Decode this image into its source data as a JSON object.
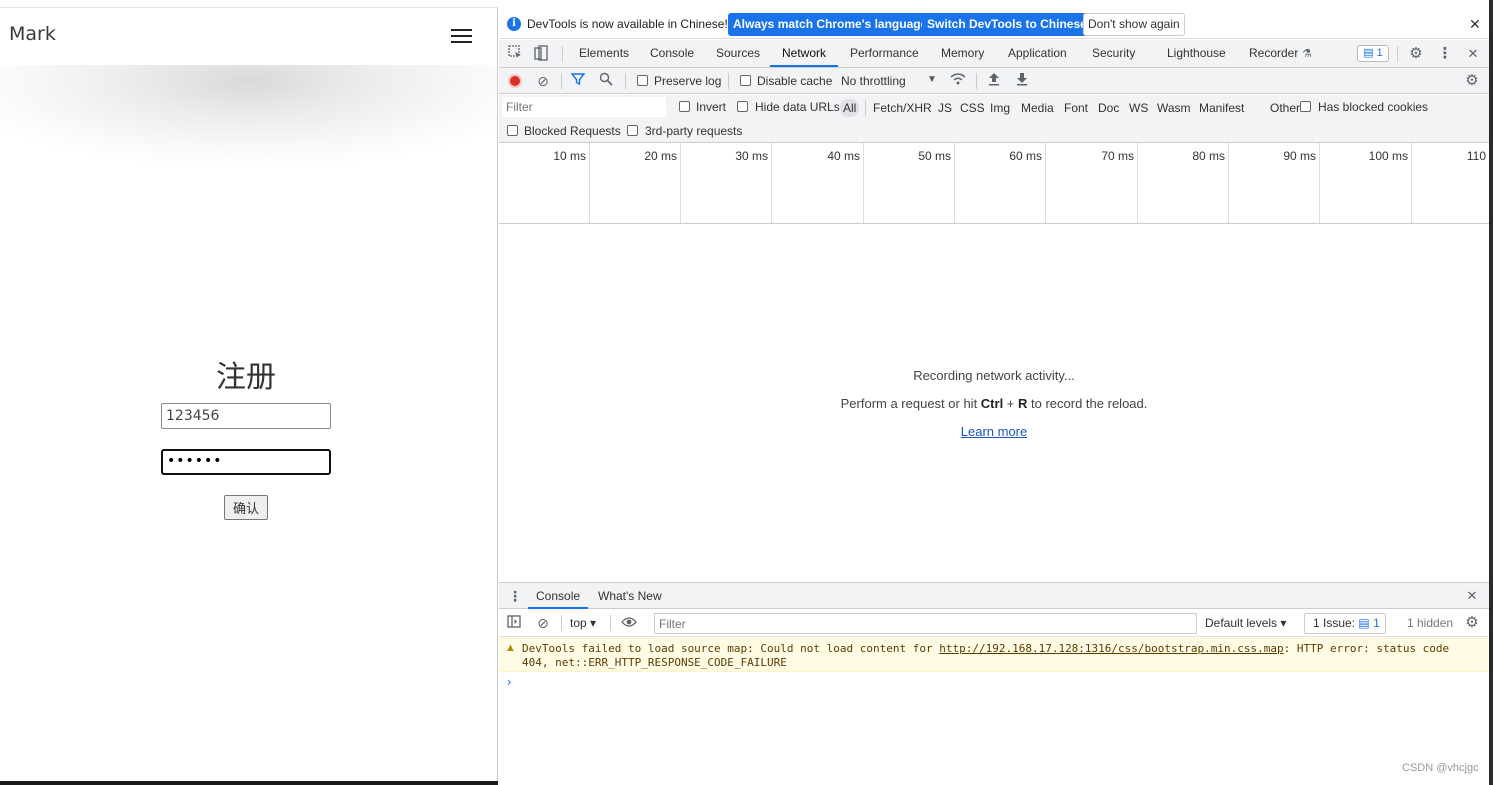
{
  "page": {
    "brand": "Mark",
    "title": "注册",
    "username_value": "123456",
    "password_mask": "••••••",
    "submit_label": "确认"
  },
  "devtools": {
    "infobar": {
      "message": "DevTools is now available in Chinese!",
      "btn_match": "Always match Chrome's language",
      "btn_switch": "Switch DevTools to Chinese",
      "btn_dismiss": "Don't show again",
      "close": "✕"
    },
    "tabs": [
      "Elements",
      "Console",
      "Sources",
      "Network",
      "Performance",
      "Memory",
      "Application",
      "Security",
      "Lighthouse",
      "Recorder"
    ],
    "active_tab": "Network",
    "issues_badge": "1",
    "network_toolbar": {
      "preserve_log": "Preserve log",
      "disable_cache": "Disable cache",
      "throttling": "No throttling"
    },
    "filter": {
      "placeholder": "Filter",
      "invert": "Invert",
      "hide_data_urls": "Hide data URLs",
      "types": [
        "All",
        "Fetch/XHR",
        "JS",
        "CSS",
        "Img",
        "Media",
        "Font",
        "Doc",
        "WS",
        "Wasm",
        "Manifest",
        "Other"
      ],
      "active_type": "All",
      "has_blocked_cookies": "Has blocked cookies",
      "blocked_requests": "Blocked Requests",
      "third_party": "3rd-party requests"
    },
    "timeline_ticks": [
      "10 ms",
      "20 ms",
      "30 ms",
      "40 ms",
      "50 ms",
      "60 ms",
      "70 ms",
      "80 ms",
      "90 ms",
      "100 ms",
      "110"
    ],
    "empty_state": {
      "line1": "Recording network activity...",
      "line2_prefix": "Perform a request or hit ",
      "shortcut_ctrl": "Ctrl",
      "shortcut_plus": " + ",
      "shortcut_r": "R",
      "line2_suffix": " to record the reload.",
      "learn_more": "Learn more"
    },
    "drawer": {
      "tabs": [
        "Console",
        "What's New"
      ],
      "context": "top",
      "filter_placeholder": "Filter",
      "levels": "Default levels",
      "issues_label": "1 Issue:",
      "issues_count": "1",
      "hidden": "1 hidden"
    },
    "console_warning": {
      "prefix": "DevTools failed to load source map: Could not load content for ",
      "url": "http://192.168.17.128:1316/css/bootstrap.min.css.map",
      "suffix": ": HTTP error: status code 404, net::ERR_HTTP_RESPONSE_CODE_FAILURE"
    },
    "prompt": "›"
  },
  "watermark": "CSDN @vhcjgc",
  "colors": {
    "accent": "#1a73e8",
    "record": "#d93025",
    "warning_bg": "#fffbe5",
    "toolbar_bg": "#f1f3f4"
  },
  "icons": [
    "inspect-element-icon",
    "device-toolbar-icon",
    "record-icon",
    "clear-icon",
    "filter-icon",
    "search-icon",
    "network-conditions-icon",
    "import-har-icon",
    "export-har-icon",
    "settings-icon",
    "more-icon",
    "close-icon",
    "hamburger-icon",
    "info-icon",
    "warning-icon",
    "sidebar-toggle-icon",
    "eye-icon"
  ]
}
